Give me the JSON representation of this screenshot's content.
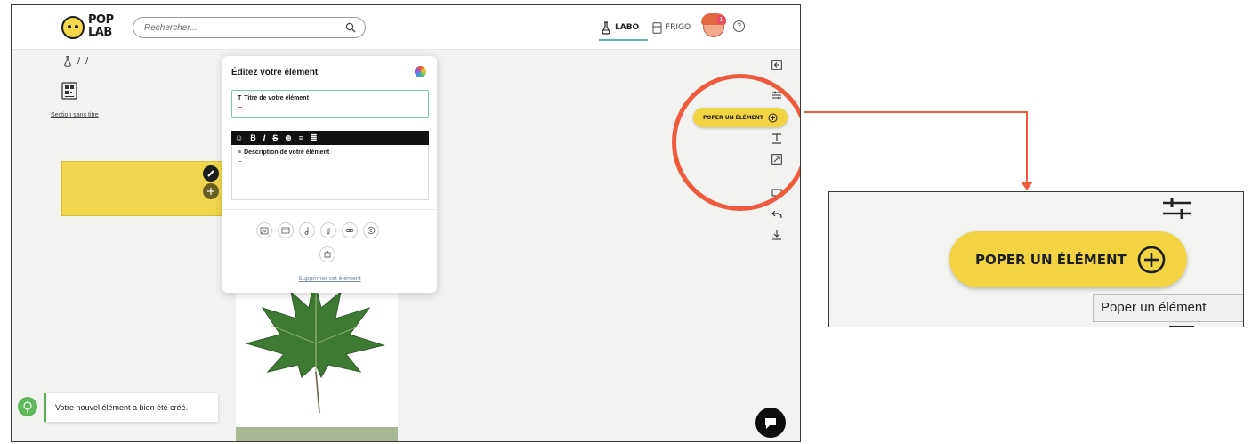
{
  "header": {
    "logo_line1": "POP",
    "logo_line2": "LAB",
    "search_placeholder": "Rechercher...",
    "nav_labo": "LABO",
    "nav_frigo": "FRIGO",
    "notification_count": "1",
    "help_label": "?"
  },
  "breadcrumb": {
    "separator1": "/",
    "separator2": "/"
  },
  "section": {
    "link_label": "Section sans titre"
  },
  "edit_panel": {
    "title": "Éditez votre élément",
    "title_field_label": "Titre de votre élément",
    "toolbar": [
      "☺",
      "B",
      "I",
      "S",
      "⊕",
      "≡",
      "≣"
    ],
    "description_field_label": "Description de votre élément",
    "delete_label": "Supprimer cet élément"
  },
  "tools": {
    "poper_label": "POPER UN ÉLÉMENT"
  },
  "toast": {
    "message": "Votre nouvel élément a bien été créé."
  },
  "zoom": {
    "poper_label": "POPER UN ÉLÉMENT",
    "tooltip": "Poper un élément"
  },
  "colors": {
    "accent_yellow": "#f2d443",
    "highlight_red": "#f05a3c",
    "success_green": "#5fb85a",
    "labo_teal": "#5bb8a6"
  }
}
